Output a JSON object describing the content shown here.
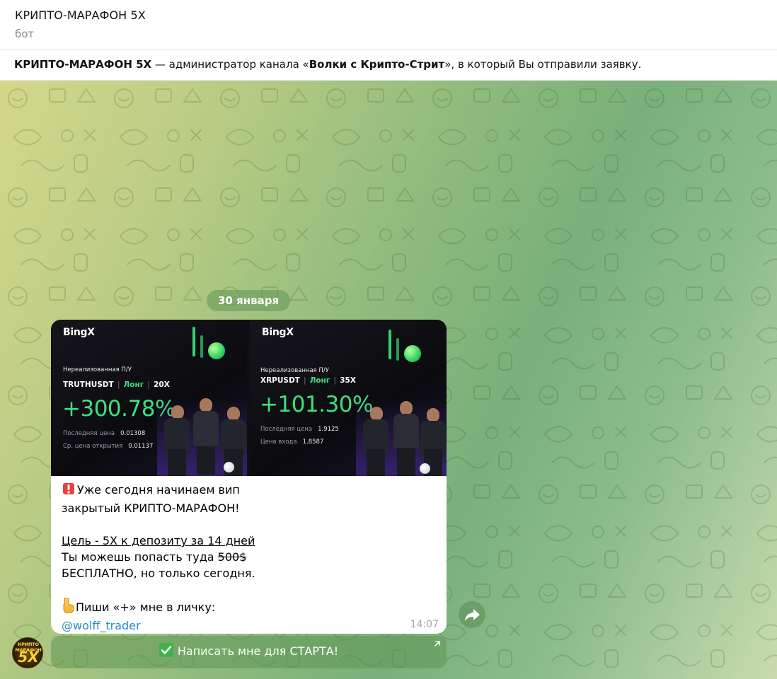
{
  "header": {
    "title": "КРИПТО-МАРАФОН 5X",
    "subtitle": "бот"
  },
  "notice": {
    "bot_name": "КРИПТО-МАРАФОН 5X",
    "text_before": " — администратор канала «",
    "channel": "Волки с Крипто-Стрит",
    "text_after": "», в который Вы отправили заявку."
  },
  "chat": {
    "date_separator": "30 января",
    "message": {
      "media": [
        {
          "brand": "BingX",
          "pnl_label": "Нереализованная П/У",
          "symbol": "TRUTHUSDT",
          "side": "Лонг",
          "leverage": "20X",
          "pnl": "+300.78%",
          "row1_label": "Последняя цена",
          "row1_value": "0.01308",
          "row2_label": "Ср. цена открытия",
          "row2_value": "0.01137"
        },
        {
          "brand": "BingX",
          "pnl_label": "Нереализованная П/У",
          "symbol": "XRPUSDT",
          "side": "Лонг",
          "leverage": "35X",
          "pnl": "+101.30%",
          "row1_label": "Последняя цена",
          "row1_value": "1.9125",
          "row2_label": "Цена входа",
          "row2_value": "1.8587"
        }
      ],
      "line1": "Уже сегодня начинаем вип",
      "line2": "закрытый КРИПТО-МАРАФОН!",
      "goal": "Цель - 5X к депозиту за 14 дней",
      "line4_before": "Ты можешь попасть туда ",
      "price_struck": "500$",
      "line5": "БЕСПЛАТНО, но только сегодня.",
      "cta_text": "Пиши «+» мне в личку:",
      "username": "@wolff_trader",
      "time": "14:07",
      "emoji_siren": "siren-emoji",
      "emoji_point": "point-down-emoji"
    },
    "inline_button": {
      "label": "Написать мне для СТАРТА!",
      "icon": "check-mark-emoji"
    },
    "avatar": {
      "line1": "КРИПТО МАРАФОН",
      "line2": "5X"
    }
  },
  "colors": {
    "accent_green": "#3ee07e",
    "link": "#2a8ac6",
    "date_pill": "#609656"
  }
}
